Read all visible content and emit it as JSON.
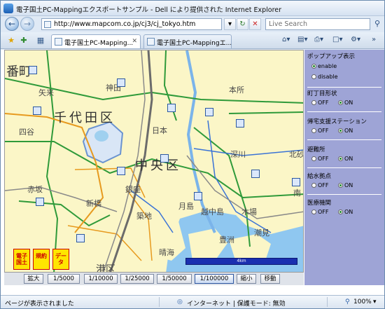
{
  "window": {
    "title": "電子国土PC-Mappingエクスポートサンプル - Dell により提供された Internet Explorer"
  },
  "address_bar": {
    "url": "http://www.mapcom.co.jp/cj3/cj_tokyo.htm"
  },
  "search": {
    "placeholder": "Live Search"
  },
  "tabs": [
    {
      "label": "電子国土PC-Mapping..."
    },
    {
      "label": "電子国土PC-Mappingエ..."
    }
  ],
  "map": {
    "labels": [
      "番町",
      "矢来",
      "四谷",
      "神田",
      "千代田区",
      "赤坂",
      "新橋",
      "銀座",
      "中央区",
      "築地",
      "月島",
      "越中島",
      "木場",
      "晴海",
      "豊洲",
      "潮見",
      "本所",
      "深川",
      "北砂",
      "南",
      "港区",
      "日本"
    ],
    "side_buttons": [
      "電子国土",
      "規約",
      "データ"
    ],
    "scale_label": "4km"
  },
  "zoom_toolbar": {
    "buttons": [
      "拡大",
      "1/5000",
      "1/10000",
      "1/25000",
      "1/50000",
      "1/100000",
      "縮小",
      "移動"
    ],
    "selected": "1/100000"
  },
  "panel": {
    "popup": {
      "title": "ポップアップ表示",
      "options": [
        "enable",
        "disable"
      ],
      "selected": "enable"
    },
    "groups": [
      {
        "title": "町丁目形状",
        "off": "OFF",
        "on": "ON",
        "selected": "ON"
      },
      {
        "title": "帰宅支援ステーション",
        "off": "OFF",
        "on": "ON",
        "selected": "ON"
      },
      {
        "title": "避難所",
        "off": "OFF",
        "on": "ON",
        "selected": "ON"
      },
      {
        "title": "給水拠点",
        "off": "OFF",
        "on": "ON",
        "selected": "ON"
      },
      {
        "title": "医療機関",
        "off": "OFF",
        "on": "ON",
        "selected": "ON"
      }
    ]
  },
  "status": {
    "left": "ページが表示されました",
    "zone": "インターネット | 保護モード: 無効",
    "zoom": "100%"
  },
  "colors": {
    "map_bg": "#fbf6c7",
    "panel_bg": "#9ea4d6",
    "green_road": "#2f9a3a",
    "blue_road": "#3a73d6",
    "orange_road": "#e79a1f"
  }
}
